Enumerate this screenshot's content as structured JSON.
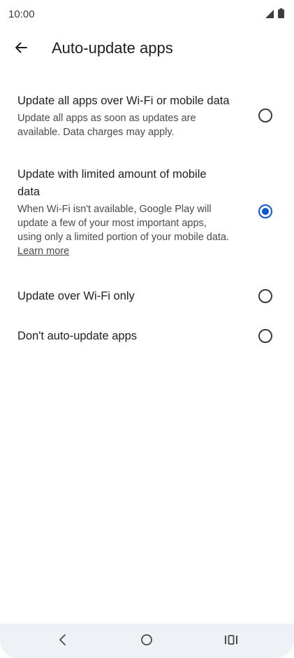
{
  "status_bar": {
    "time": "10:00",
    "icons": [
      "signal-icon",
      "battery-icon"
    ]
  },
  "app_bar": {
    "back_icon": "arrow-left-icon",
    "title": "Auto-update apps"
  },
  "options": [
    {
      "title": "Update all apps over Wi-Fi or mobile data",
      "description": "Update all apps as soon as updates are available. Data charges may apply.",
      "selected": false
    },
    {
      "title": "Update with limited amount of mobile data",
      "description": "When Wi-Fi isn't available, Google Play will update a few of your most important apps, using only a limited portion of your mobile data.",
      "link": "Learn more",
      "selected": true
    },
    {
      "title": "Update over Wi-Fi only",
      "selected": false
    },
    {
      "title": "Don't auto-update apps",
      "selected": false
    }
  ],
  "nav_bar": {
    "icons": [
      "back-icon",
      "home-icon",
      "recents-icon"
    ]
  },
  "colors": {
    "accent": "#0b57d0",
    "text": "#1f1f1f",
    "secondary_text": "#4a4a4a",
    "nav_background": "#eef1f5"
  }
}
